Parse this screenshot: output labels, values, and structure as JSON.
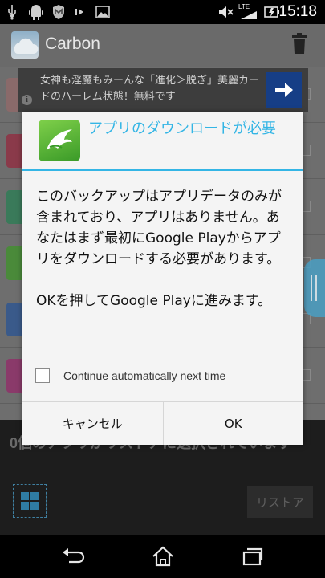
{
  "status_bar": {
    "time": "15:18",
    "network_type": "LTE",
    "left_icons": [
      "usb-icon",
      "android-icon",
      "mcafee-icon",
      "media-icon",
      "gallery-icon"
    ],
    "right_icons": [
      "mute-icon",
      "signal-icon",
      "battery-icon"
    ]
  },
  "app": {
    "title": "Carbon",
    "restore_status": "0個のアプリがリストアに選択されています",
    "restore_button": "リストア"
  },
  "ad": {
    "text": "女神も淫魔もみーんな「進化＞脱ぎ」美麗カードのハーレム状態！無料です",
    "info_glyph": "i"
  },
  "dialog": {
    "title": "アプリのダウンロードが必要",
    "message_1": "このバックアップはアプリデータのみが含まれており、アプリはありません。あなたはまず最初にGoogle Playからアプリをダウンロードする必要があります。",
    "message_2": "OKを押してGoogle Playに進みます。",
    "checkbox_label": "Continue automatically next time",
    "checkbox_checked": false,
    "cancel_label": "キャンセル",
    "ok_label": "OK"
  },
  "colors": {
    "accent": "#33b5e5",
    "ad_button": "#163e86"
  }
}
